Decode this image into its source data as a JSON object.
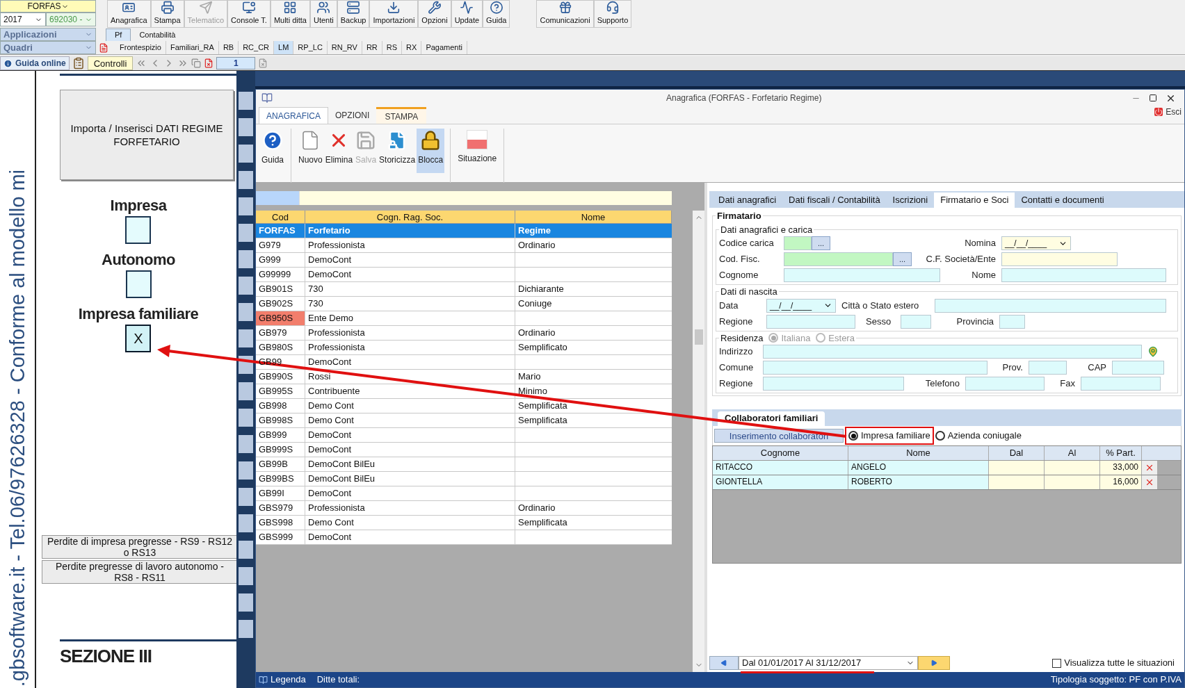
{
  "top": {
    "company_combo": "FORFAS",
    "year_combo": "2017",
    "code_combo": "692030 -",
    "applicazioni_combo": "Applicazioni",
    "quadri_combo": "Quadri"
  },
  "toolbar": [
    {
      "label": "Anagrafica",
      "kind": "id-card",
      "disabled": false
    },
    {
      "label": "Stampa",
      "kind": "printer",
      "disabled": false
    },
    {
      "label": "Telematico",
      "kind": "send",
      "disabled": true
    },
    {
      "label": "Console T.",
      "kind": "monitor",
      "disabled": false
    },
    {
      "label": "Multi ditta",
      "kind": "grid",
      "disabled": false
    },
    {
      "label": "Utenti",
      "kind": "users",
      "disabled": false
    },
    {
      "label": "Backup",
      "kind": "server",
      "disabled": false
    },
    {
      "label": "Importazioni",
      "kind": "download",
      "disabled": false
    },
    {
      "label": "Opzioni",
      "kind": "wrench",
      "disabled": false
    },
    {
      "label": "Update",
      "kind": "activity",
      "disabled": false
    },
    {
      "label": "Guida",
      "kind": "help",
      "disabled": false
    },
    {
      "label": "Comunicazioni",
      "kind": "gift",
      "disabled": false
    },
    {
      "label": "Supporto",
      "kind": "headset",
      "disabled": false
    }
  ],
  "module_tabs": [
    {
      "label": "Pf",
      "selected": true
    },
    {
      "label": "Contabilità",
      "selected": false
    }
  ],
  "quadri_tabs": [
    {
      "label": "Frontespizio",
      "selected": false
    },
    {
      "label": "Familiari_RA",
      "selected": false
    },
    {
      "label": "RB",
      "selected": false
    },
    {
      "label": "RC_CR",
      "selected": false
    },
    {
      "label": "LM",
      "selected": true
    },
    {
      "label": "RP_LC",
      "selected": false
    },
    {
      "label": "RN_RV",
      "selected": false
    },
    {
      "label": "RR",
      "selected": false
    },
    {
      "label": "RS",
      "selected": false
    },
    {
      "label": "RX",
      "selected": false
    },
    {
      "label": "Pagamenti",
      "selected": false
    }
  ],
  "nav_bar": {
    "guida_online": "Guida online",
    "controlli": "Controlli",
    "page": "1"
  },
  "document": {
    "side_text": ".gbsoftware.it - Tel.06/97626328 - Conforme al modello mi",
    "import_button": "Importa / Inserisci DATI REGIME FORFETARIO",
    "checks": [
      {
        "label": "Impresa",
        "checked": false
      },
      {
        "label": "Autonomo",
        "checked": false
      },
      {
        "label": "Impresa familiare",
        "checked": true,
        "value": "X"
      }
    ],
    "loss_buttons": [
      "Perdite di impresa pregresse - RS9 - RS12 o RS13",
      "Perdite pregresse di lavoro autonomo -  RS8 - RS11"
    ],
    "section_title": "SEZIONE III"
  },
  "dialog": {
    "title": "Anagrafica (FORFAS - Forfetario Regime)",
    "exit": "Esci",
    "ribbon_tabs": [
      {
        "label": "ANAGRAFICA",
        "selected": true,
        "contextual": false
      },
      {
        "label": "OPZIONI",
        "selected": false,
        "contextual": false
      },
      {
        "label": "STAMPA",
        "selected": false,
        "contextual": true
      }
    ],
    "ribbon_buttons": [
      {
        "label": "Guida",
        "kind": "help",
        "disabled": false,
        "active": false
      },
      {
        "label": "Nuovo",
        "kind": "new",
        "disabled": false,
        "active": false
      },
      {
        "label": "Elimina",
        "kind": "delete",
        "disabled": false,
        "active": false
      },
      {
        "label": "Salva",
        "kind": "save",
        "disabled": true,
        "active": false
      },
      {
        "label": "Storicizza",
        "kind": "archive",
        "disabled": false,
        "active": false
      },
      {
        "label": "Blocca",
        "kind": "lock",
        "disabled": false,
        "active": true
      },
      {
        "label": "Situazione",
        "kind": "status",
        "disabled": false,
        "active": false
      }
    ],
    "grid": {
      "columns": [
        "Cod",
        "Cogn. Rag. Soc.",
        "Nome"
      ],
      "rows": [
        {
          "cod": "FORFAS",
          "name": "Forfetario",
          "nome": "Regime",
          "selected": true,
          "flagged": false
        },
        {
          "cod": "G979",
          "name": "Professionista",
          "nome": "Ordinario",
          "selected": false,
          "flagged": false
        },
        {
          "cod": "G999",
          "name": "DemoCont",
          "selected": false,
          "flagged": false
        },
        {
          "cod": "G99999",
          "name": "DemoCont",
          "selected": false,
          "flagged": false
        },
        {
          "cod": "GB901S",
          "name": "730",
          "nome": "Dichiarante",
          "selected": false,
          "flagged": false
        },
        {
          "cod": "GB902S",
          "name": "730",
          "nome": "Coniuge",
          "selected": false,
          "flagged": false
        },
        {
          "cod": "GB950S",
          "name": "Ente Demo",
          "selected": false,
          "flagged": true
        },
        {
          "cod": "GB979",
          "name": "Professionista",
          "nome": "Ordinario",
          "selected": false,
          "flagged": false
        },
        {
          "cod": "GB980S",
          "name": "Professionista",
          "nome": "Semplificato",
          "selected": false,
          "flagged": false
        },
        {
          "cod": "GB99",
          "name": "DemoCont",
          "selected": false,
          "flagged": false
        },
        {
          "cod": "GB990S",
          "name": "Rossi",
          "nome": "Mario",
          "selected": false,
          "flagged": false
        },
        {
          "cod": "GB995S",
          "name": "Contribuente",
          "nome": "Minimo",
          "selected": false,
          "flagged": false
        },
        {
          "cod": "GB998",
          "name": "Demo Cont",
          "nome": "Semplificata",
          "selected": false,
          "flagged": false
        },
        {
          "cod": "GB998S",
          "name": "Demo Cont",
          "nome": "Semplificata",
          "selected": false,
          "flagged": false
        },
        {
          "cod": "GB999",
          "name": "DemoCont",
          "selected": false,
          "flagged": false
        },
        {
          "cod": "GB999S",
          "name": "DemoCont",
          "selected": false,
          "flagged": false
        },
        {
          "cod": "GB99B",
          "name": "DemoCont BilEu",
          "selected": false,
          "flagged": false
        },
        {
          "cod": "GB99BS",
          "name": "DemoCont BilEu",
          "selected": false,
          "flagged": false
        },
        {
          "cod": "GB99I",
          "name": "DemoCont",
          "selected": false,
          "flagged": false
        },
        {
          "cod": "GBS979",
          "name": "Professionista",
          "nome": "Ordinario",
          "selected": false,
          "flagged": false
        },
        {
          "cod": "GBS998",
          "name": "Demo Cont",
          "nome": "Semplificata",
          "selected": false,
          "flagged": false
        },
        {
          "cod": "GBS999",
          "name": "DemoCont",
          "selected": false,
          "flagged": false
        }
      ]
    },
    "detail_tabs": [
      {
        "label": "Dati anagrafici",
        "selected": false
      },
      {
        "label": "Dati fiscali / Contabilità",
        "selected": false
      },
      {
        "label": "Iscrizioni",
        "selected": false
      },
      {
        "label": "Firmatario e Soci",
        "selected": true
      },
      {
        "label": "Contatti e documenti",
        "selected": false
      }
    ],
    "firmatario": {
      "title": "Firmatario",
      "carica": {
        "legend": "Dati anagrafici e carica",
        "codice_carica": "Codice carica",
        "lookup_1": "...",
        "nomina": "Nomina",
        "nomina_value": "__/__/____",
        "cod_fisc": "Cod. Fisc.",
        "lookup_2": "...",
        "cf_societa": "C.F. Società/Ente",
        "cognome": "Cognome",
        "nome": "Nome"
      },
      "nascita": {
        "legend": "Dati di nascita",
        "data": "Data",
        "data_value": "__/__/____",
        "citta": "Città o Stato estero",
        "regione": "Regione",
        "sesso": "Sesso",
        "provincia": "Provincia"
      },
      "residenza": {
        "legend": "Residenza",
        "options": [
          {
            "label": "Italiana",
            "selected": true
          },
          {
            "label": "Estera",
            "selected": false
          }
        ],
        "indirizzo": "Indirizzo",
        "comune": "Comune",
        "prov": "Prov.",
        "cap": "CAP",
        "regione": "Regione",
        "telefono": "Telefono",
        "fax": "Fax"
      }
    },
    "collaboratori": {
      "tab": "Collaboratori familiari",
      "insert_button": "Inserimento collaboratori",
      "options": [
        {
          "label": "Impresa familiare",
          "selected": true
        },
        {
          "label": "Azienda coniugale",
          "selected": false
        }
      ],
      "columns": [
        "Cognome",
        "Nome",
        "Dal",
        "Al",
        "% Part."
      ],
      "rows": [
        {
          "cognome": "RITACCO",
          "nome": "ANGELO",
          "part": "33,000"
        },
        {
          "cognome": "GIONTELLA",
          "nome": "ROBERTO",
          "part": "16,000"
        }
      ]
    },
    "period": "Dal 01/01/2017 Al 31/12/2017",
    "show_all": {
      "label": "Visualizza tutte le situazioni",
      "checked": false
    },
    "status": {
      "legend": "Legenda",
      "totals": "Ditte totali:",
      "type": "Tipologia soggetto: PF con P.IVA"
    }
  }
}
